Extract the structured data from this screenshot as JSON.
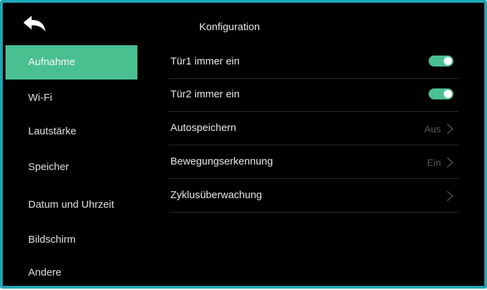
{
  "header": {
    "back_icon": "back-arrow-icon",
    "title": "Konfiguration"
  },
  "sidebar": {
    "items": [
      {
        "label": "Aufnahme",
        "active": true
      },
      {
        "label": "Wi-Fi",
        "active": false
      },
      {
        "label": "Lautstärke",
        "active": false
      },
      {
        "label": "Speicher",
        "active": false
      },
      {
        "label": "Datum und Uhrzeit",
        "active": false
      },
      {
        "label": "Bildschirm",
        "active": false
      },
      {
        "label": "Andere",
        "active": false
      }
    ]
  },
  "settings": {
    "rows": [
      {
        "label": "Tür1 immer ein",
        "control": "toggle",
        "on": true
      },
      {
        "label": "Tür2 immer ein",
        "control": "toggle",
        "on": true
      },
      {
        "label": "Autospeichern",
        "control": "submenu",
        "value": "Aus"
      },
      {
        "label": "Bewegungserkennung",
        "control": "submenu",
        "value": "Ein"
      },
      {
        "label": "Zyklusüberwachung",
        "control": "submenu",
        "value": ""
      }
    ]
  },
  "colors": {
    "accent": "#49c08f",
    "frame": "#1fa7b8",
    "background": "#000000"
  }
}
